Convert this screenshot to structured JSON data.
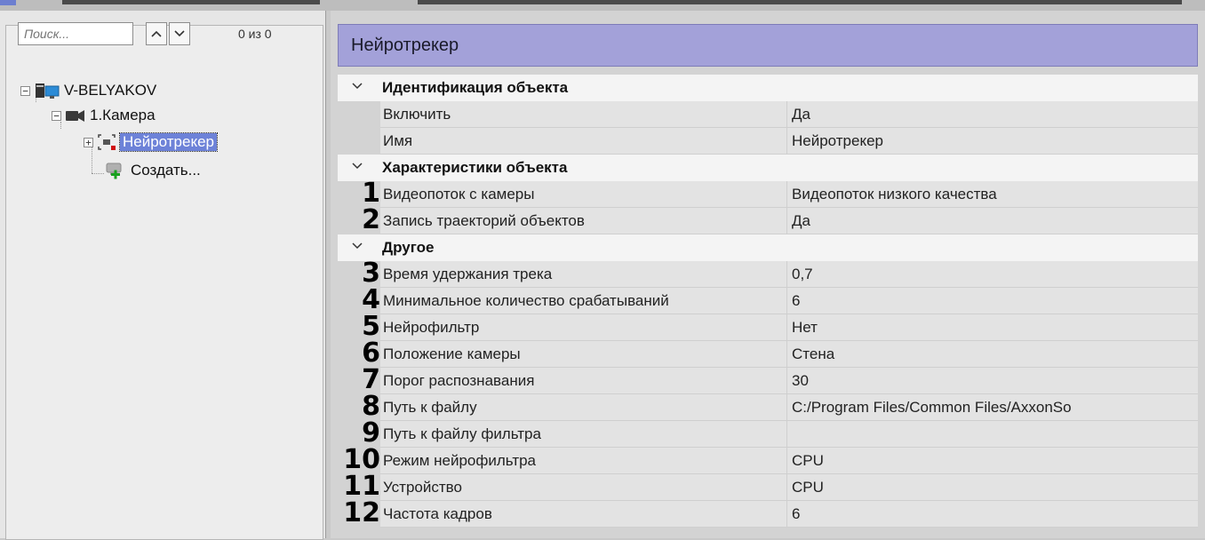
{
  "search": {
    "placeholder": "Поиск...",
    "counter": "0 из 0"
  },
  "tree": {
    "server": "V-BELYAKOV",
    "camera": "1.Камера",
    "detector": "Нейротрекер",
    "create": "Создать..."
  },
  "panel_title": "Нейротрекер",
  "categories": {
    "identification": "Идентификация объекта",
    "characteristics": "Характеристики объекта",
    "other": "Другое"
  },
  "properties": [
    {
      "num": "",
      "name": "Включить",
      "value": "Да"
    },
    {
      "num": "",
      "name": "Имя",
      "value": "Нейротрекер"
    },
    {
      "num": "1",
      "name": "Видеопоток с камеры",
      "value": "Видеопоток низкого качества"
    },
    {
      "num": "2",
      "name": "Запись траекторий объектов",
      "value": "Да"
    },
    {
      "num": "3",
      "name": "Время удержания трека",
      "value": "0,7"
    },
    {
      "num": "4",
      "name": "Минимальное количество срабатываний",
      "value": "6"
    },
    {
      "num": "5",
      "name": "Нейрофильтр",
      "value": "Нет"
    },
    {
      "num": "6",
      "name": "Положение камеры",
      "value": "Стена"
    },
    {
      "num": "7",
      "name": "Порог распознавания",
      "value": "30"
    },
    {
      "num": "8",
      "name": "Путь к файлу",
      "value": "C:/Program Files/Common Files/AxxonSo"
    },
    {
      "num": "9",
      "name": "Путь к файлу фильтра",
      "value": ""
    },
    {
      "num": "10",
      "name": "Режим нейрофильтра",
      "value": "CPU"
    },
    {
      "num": "11",
      "name": "Устройство",
      "value": "CPU"
    },
    {
      "num": "12",
      "name": "Частота кадров",
      "value": "6"
    }
  ],
  "colors": {
    "header_bg": "#a3a1d9",
    "selection": "#6d82d8"
  }
}
